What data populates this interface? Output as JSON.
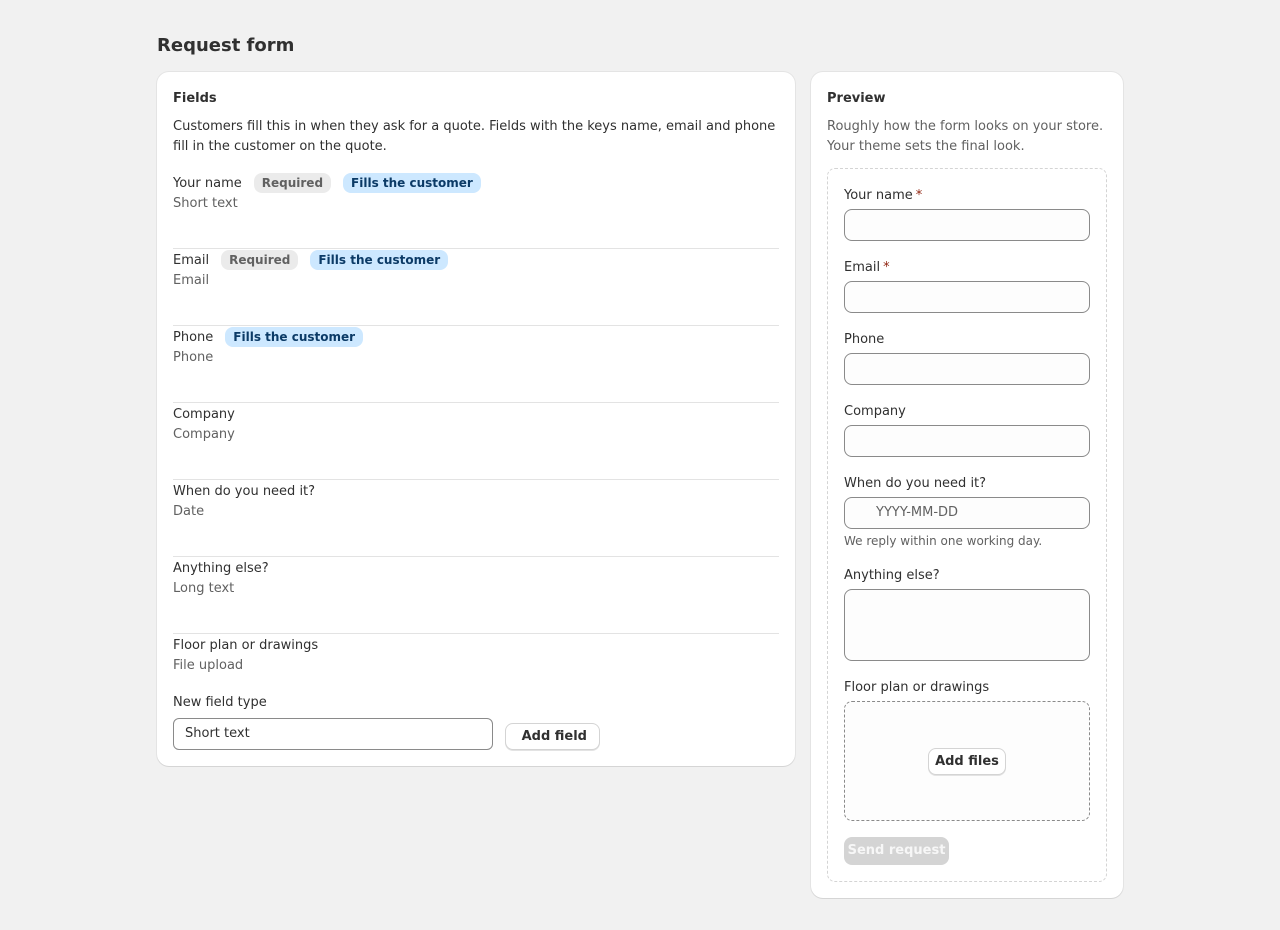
{
  "page": {
    "title": "Request form"
  },
  "fields_card": {
    "title": "Fields",
    "description": "Customers fill this in when they ask for a quote. Fields with the keys name, email and phone fill in the customer on the quote.",
    "fields": [
      {
        "name": "Your name",
        "type": "Short text",
        "required_badge": "Required",
        "fills_badge": "Fills the customer"
      },
      {
        "name": "Email",
        "type": "Email",
        "required_badge": "Required",
        "fills_badge": "Fills the customer"
      },
      {
        "name": "Phone",
        "type": "Phone",
        "fills_badge": "Fills the customer"
      },
      {
        "name": "Company",
        "type": "Company"
      },
      {
        "name": "When do you need it?",
        "type": "Date"
      },
      {
        "name": "Anything else?",
        "type": "Long text"
      },
      {
        "name": "Floor plan or drawings",
        "type": "File upload"
      }
    ],
    "new_field": {
      "label": "New field type",
      "selected": "Short text",
      "add_button": "Add field"
    }
  },
  "preview_card": {
    "title": "Preview",
    "description": "Roughly how the form looks on your store. Your theme sets the final look.",
    "form": {
      "your_name_label": "Your name",
      "email_label": "Email",
      "required_marker": "*",
      "phone_label": "Phone",
      "company_label": "Company",
      "date_label": "When do you need it?",
      "date_placeholder": "YYYY-MM-DD",
      "date_help": "We reply within one working day.",
      "anything_else_label": "Anything else?",
      "floor_plan_label": "Floor plan or drawings",
      "add_files_button": "Add files",
      "send_button": "Send request"
    }
  }
}
